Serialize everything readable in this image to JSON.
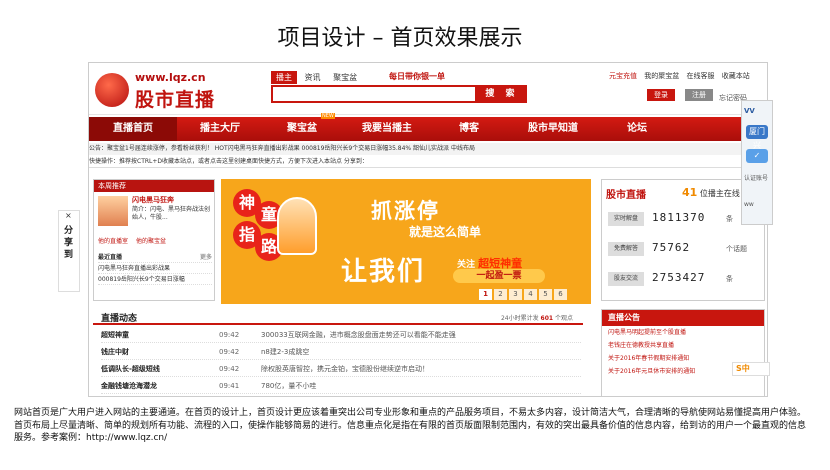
{
  "slide": {
    "title": "项目设计 – 首页效果展示",
    "description": "网站首页是广大用户进入网站的主要通道。在首页的设计上，首页设计更应该着重突出公司专业形象和重点的产品服务项目，不易太多内容，设计简洁大气，合理清晰的导航使网站易懂提高用户体验。首页布局上尽量清晰、简单的规划所有功能、流程的入口，使操作能够简易的进行。信息重点化是指在有限的首页版面限制范围内，有效的突出最具备价值的信息内容，给到访的用户一个最直观的信息服务。参考案例：http://www.lqz.cn/"
  },
  "header": {
    "logo_url": "www.lqz.cn",
    "logo_cn": "股市直播",
    "search_tabs": [
      "播主",
      "资讯",
      "聚宝盆"
    ],
    "slogan": "每日带你银一单",
    "search_button": "搜 索",
    "top_links": [
      "元宝充值",
      "我的聚宝盆",
      "在线客服",
      "收藏本站"
    ],
    "login": "登录",
    "register": "注册",
    "forgot": "忘记密码"
  },
  "nav": {
    "items": [
      "直播首页",
      "播主大厅",
      "聚宝盆",
      "我要当播主",
      "博客",
      "股市早知道",
      "论坛"
    ],
    "hot_badge": "NEW"
  },
  "ticker": {
    "line1": "公告：聚宝盆1号届连续涨停，参看粉丝获利！ HOT闪电黑马狂奔直播出彩战果 000819岳阳兴长9个交易日涨幅35.84% 韶仙儿实战派 中线布局",
    "line2": "快捷操作：推荐按CTRL+D收藏本站点，或者点击这里创建桌面快捷方式，方便下次进入本站点 分享到："
  },
  "left_box": {
    "header": "本周推荐",
    "name": "闪电黑马狂奔",
    "intro": "简介：闪电、黑马狂奔战法创始人，牛股...",
    "links": [
      "他的直播室",
      "他的聚宝盆"
    ],
    "sub_header": "最近直播",
    "sub_more": "更多",
    "sub_items": [
      "闪电黑马狂奔直播出彩战果",
      "000819岳阳兴长9个交易日涨幅"
    ]
  },
  "banner": {
    "circle_chars": [
      "神",
      "童",
      "指",
      "路"
    ],
    "headline": "抓涨停",
    "subline": "就是这么简单",
    "main": "让我们",
    "focus_prefix": "关注",
    "focus_highlight": "超短神童",
    "pill": "一起盈一票",
    "pages": [
      "1",
      "2",
      "3",
      "4",
      "5",
      "6"
    ],
    "active_page": "1"
  },
  "stats": {
    "logo": "股市直播",
    "count_value": "41",
    "count_suffix": "位播主在线",
    "rows": [
      {
        "label": "实时解盘",
        "value": "1811370",
        "unit": "条"
      },
      {
        "label": "免费解答",
        "value": "75762",
        "unit": "个话题"
      },
      {
        "label": "股友交流",
        "value": "2753427",
        "unit": "条"
      }
    ]
  },
  "live": {
    "title": "直播动态",
    "count_prefix": "24小时累计发",
    "count_value": "601",
    "count_suffix": "个观点",
    "rows": [
      {
        "name": "超短神童",
        "time": "09:42",
        "content": "300033互联网金融，进市概念股盘面走势还可以看能不能走强"
      },
      {
        "name": "钱庄中财",
        "time": "09:42",
        "content": "n8建2-3成跳空"
      },
      {
        "name": "低调队长-超级短线",
        "time": "09:42",
        "content": "除权股英唐智控，携元金铂，宝德股份继续逆市启动！"
      },
      {
        "name": "金融钱塘沧海潜龙",
        "time": "09:41",
        "content": "780亿，量不小哇"
      }
    ]
  },
  "notice": {
    "title": "直播公告",
    "items": [
      "闪电黑马明起提前至个股直播",
      "老钱庄在德教授共享直播",
      "关于2016年春节假期安排通知",
      "关于2016年元旦休市安排的通知"
    ]
  },
  "side_widget": {
    "brand": "VV",
    "label": "厦门兴",
    "sub": "认证账号",
    "more": "ww"
  },
  "vertical_tab": {
    "close": "×",
    "text": "分享到"
  },
  "s5_badge": "S中"
}
